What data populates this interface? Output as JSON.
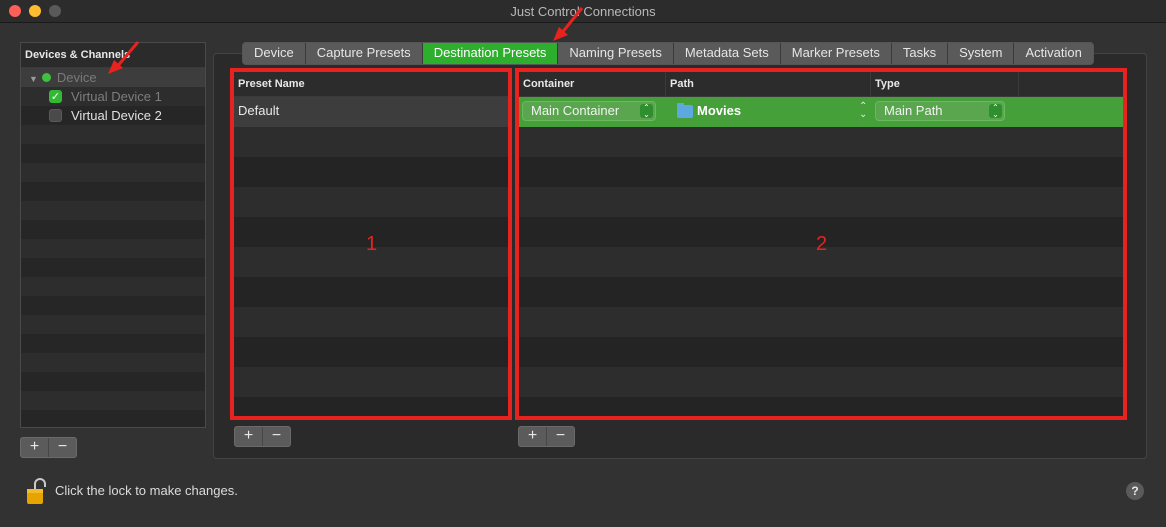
{
  "window": {
    "title": "Just Control Connections"
  },
  "sidebar": {
    "header": "Devices & Channels",
    "device": {
      "label": "Device",
      "status_color": "#3ec23e"
    },
    "channels": [
      {
        "label": "Virtual Device 1",
        "checked": true
      },
      {
        "label": "Virtual Device 2",
        "checked": false
      }
    ],
    "add_label": "+",
    "remove_label": "−"
  },
  "tabs": [
    {
      "label": "Device"
    },
    {
      "label": "Capture Presets"
    },
    {
      "label": "Destination Presets",
      "active": true
    },
    {
      "label": "Naming Presets"
    },
    {
      "label": "Metadata Sets"
    },
    {
      "label": "Marker Presets"
    },
    {
      "label": "Tasks"
    },
    {
      "label": "System"
    },
    {
      "label": "Activation"
    }
  ],
  "presets_table": {
    "header": "Preset Name",
    "rows": [
      "Default"
    ],
    "add_label": "+",
    "remove_label": "−"
  },
  "destination_table": {
    "headers": {
      "container": "Container",
      "path": "Path",
      "type": "Type"
    },
    "row": {
      "container": "Main Container",
      "path": "Movies",
      "type": "Main Path"
    },
    "add_label": "+",
    "remove_label": "−"
  },
  "annotations": {
    "box1": "1",
    "box2": "2",
    "color": "#e8231f"
  },
  "footer": {
    "lock_text": "Click the lock to make changes.",
    "help_label": "?"
  },
  "colors": {
    "accent": "#2dae2d",
    "row_selected": "#45a03a"
  }
}
